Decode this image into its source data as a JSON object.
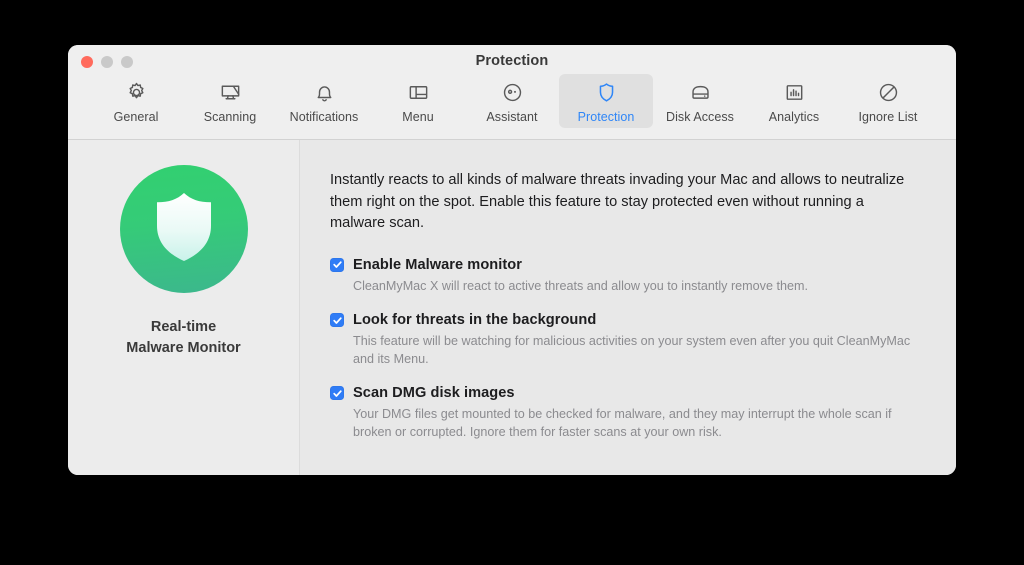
{
  "window": {
    "title": "Protection",
    "traffic_lights": [
      {
        "name": "close",
        "color": "#ff6a5c"
      },
      {
        "name": "minimize",
        "color": "#c9c9c9"
      },
      {
        "name": "maximize",
        "color": "#c9c9c9"
      }
    ]
  },
  "toolbar": {
    "selected": "Protection",
    "accent_color": "#2f86f7",
    "items": [
      {
        "label": "General",
        "icon": "gear-icon"
      },
      {
        "label": "Scanning",
        "icon": "monitor-scan-icon"
      },
      {
        "label": "Notifications",
        "icon": "bell-icon"
      },
      {
        "label": "Menu",
        "icon": "window-layout-icon"
      },
      {
        "label": "Assistant",
        "icon": "assistant-face-icon"
      },
      {
        "label": "Protection",
        "icon": "shield-icon"
      },
      {
        "label": "Disk Access",
        "icon": "hard-drive-icon"
      },
      {
        "label": "Analytics",
        "icon": "bar-chart-icon"
      },
      {
        "label": "Ignore List",
        "icon": "prohibition-icon"
      }
    ]
  },
  "sidebar": {
    "badge_icon": "shield-icon",
    "badge_gradient_from": "#32d070",
    "badge_gradient_to": "#3cb78d",
    "title": "Real-time\nMalware Monitor"
  },
  "main": {
    "intro": "Instantly reacts to all kinds of malware threats invading your Mac and allows to neutralize them right on the spot. Enable this feature to stay protected even without running a malware scan.",
    "checkbox_color": "#2f7cf6",
    "options": [
      {
        "label": "Enable Malware monitor",
        "checked": true,
        "description": "CleanMyMac X will react to active threats and allow you to instantly remove them."
      },
      {
        "label": "Look for threats in the background",
        "checked": true,
        "description": "This feature will be watching for malicious activities on your system even after you quit CleanMyMac and its Menu."
      },
      {
        "label": "Scan DMG disk images",
        "checked": true,
        "description": "Your DMG files get mounted to be checked for malware, and they may interrupt the whole scan if broken or corrupted. Ignore them for faster scans at your own risk."
      }
    ]
  }
}
